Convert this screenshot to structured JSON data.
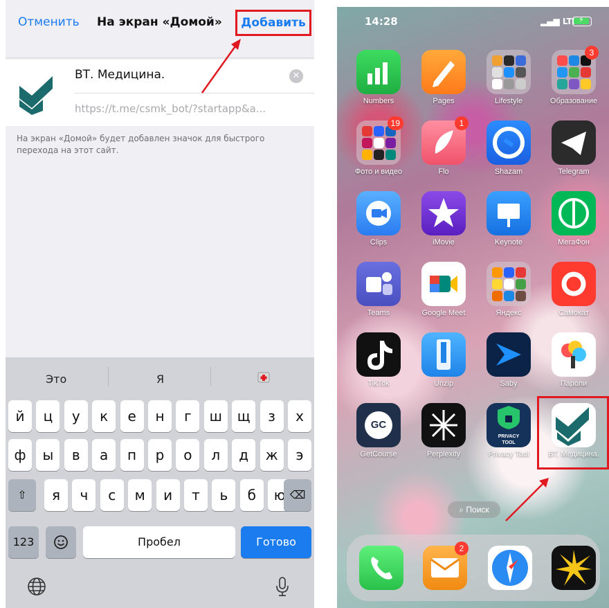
{
  "left": {
    "nav": {
      "cancel": "Отменить",
      "title": "На экран «Домой»",
      "add": "Добавить"
    },
    "form": {
      "name_value": "ВТ. Медицина.",
      "url_value": "https://t.me/csmk_bot/?startapp&a..."
    },
    "hint": "На экран «Домой» будет добавлен значок для быстрого перехода на этот сайт.",
    "keyboard": {
      "suggestions": [
        "Это",
        "Я"
      ],
      "row1": [
        "й",
        "ц",
        "у",
        "к",
        "е",
        "н",
        "г",
        "ш",
        "щ",
        "з",
        "х"
      ],
      "row2": [
        "ф",
        "ы",
        "в",
        "а",
        "п",
        "р",
        "о",
        "л",
        "д",
        "ж",
        "э"
      ],
      "row3": [
        "я",
        "ч",
        "с",
        "м",
        "и",
        "т",
        "ь",
        "б",
        "ю"
      ],
      "numbers": "123",
      "space": "Пробел",
      "done": "Готово"
    }
  },
  "right": {
    "status": {
      "time": "14:28",
      "network": "LTE"
    },
    "apps": [
      {
        "label": "Numbers"
      },
      {
        "label": "Pages"
      },
      {
        "label": "Lifestyle"
      },
      {
        "label": "Образование",
        "badge": "3"
      },
      {
        "label": "Фото и видео",
        "badge": "19"
      },
      {
        "label": "Flo",
        "badge": "1"
      },
      {
        "label": "Shazam"
      },
      {
        "label": "Telegram"
      },
      {
        "label": "Clips"
      },
      {
        "label": "iMovie"
      },
      {
        "label": "Keynote"
      },
      {
        "label": "МегаФон"
      },
      {
        "label": "Teams"
      },
      {
        "label": "Google Meet"
      },
      {
        "label": "Яндекс"
      },
      {
        "label": "Самокат"
      },
      {
        "label": "TikTok"
      },
      {
        "label": "Unzip"
      },
      {
        "label": "Saby"
      },
      {
        "label": "Пароли"
      },
      {
        "label": "GetCourse"
      },
      {
        "label": "Perplexity"
      },
      {
        "label": "Privacy Tool"
      },
      {
        "label": "ВТ. Медицина."
      }
    ],
    "search": "Поиск",
    "dock_badge": "2",
    "icon_text": {
      "gc": "GC",
      "privacy": "PRIVACY TOOL"
    }
  }
}
